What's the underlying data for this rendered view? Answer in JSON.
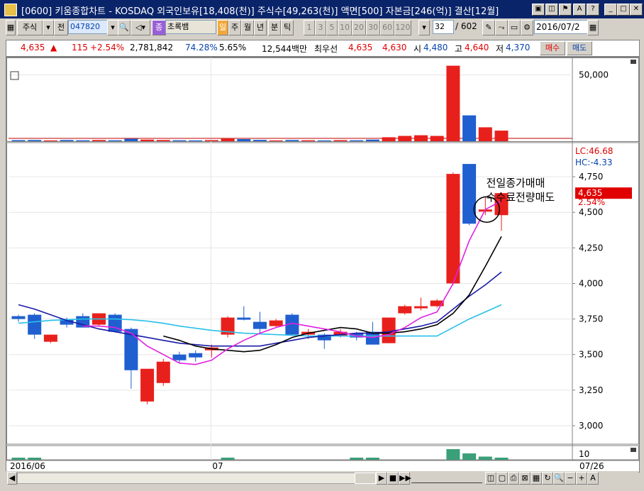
{
  "window": {
    "title": "[0600] 키움종합차트 - KOSDAQ 외국인보유[18,408(천)] 주식수[49,263(천)] 액면[500] 자본금[246(억)] 결산[12월]"
  },
  "toolbar": {
    "type_label": "주식",
    "prev_label": "전",
    "code_value": "047820",
    "color_label": "종",
    "stock_name": "초록뱀",
    "period_day": "일",
    "period_week": "주",
    "period_month": "월",
    "period_year": "년",
    "period_minute": "분",
    "period_tick": "틱",
    "intervals": [
      "1",
      "3",
      "5",
      "10",
      "20",
      "30",
      "60",
      "120"
    ],
    "count_value": "32",
    "count_total": "/ 602",
    "date_value": "2016/07/2"
  },
  "quote": {
    "price": "4,635",
    "change_arrow": "▲",
    "change": "115",
    "change_pct": "+2.54%",
    "volume": "2,781,842",
    "vol_ratio": "74.28%",
    "turnover": "5.65%",
    "amount": "12,544백만",
    "best_label": "최우선",
    "best_ask": "4,635",
    "best_bid": "4,630",
    "open_label": "시",
    "open": "4,480",
    "high_label": "고",
    "high": "4,640",
    "low_label": "저",
    "low": "4,370",
    "buy_label": "매수",
    "sell_label": "매도"
  },
  "chart_data": {
    "type": "candlestick",
    "x_tick_labels": [
      "2016/06",
      "07",
      "07/26"
    ],
    "volume_axis_ticks": [
      "50,000"
    ],
    "price_axis_ticks": [
      "4,750",
      "4,500",
      "4,250",
      "4,000",
      "3,750",
      "3,500",
      "3,250",
      "3,000"
    ],
    "indicator_axis_ticks": [
      "10"
    ],
    "lc_label": "LC:46.68",
    "hc_label": "HC:-4.33",
    "current_price_label": "4,635",
    "current_pct_label": "2.54%",
    "annotation_line1": "전일종가매매",
    "annotation_line2": "수수료전량매도",
    "colors": {
      "up": "#e8201c",
      "down": "#1f5fcf",
      "ma5": "#e020e0",
      "ma10": "#000000",
      "ma20": "#1a1aa8",
      "ma60": "#28c0e8"
    },
    "candles": [
      {
        "o": 3770,
        "h": 3780,
        "l": 3730,
        "c": 3750,
        "v": 800
      },
      {
        "o": 3780,
        "h": 3790,
        "l": 3610,
        "c": 3640,
        "v": 900
      },
      {
        "o": 3590,
        "h": 3640,
        "l": 3580,
        "c": 3640,
        "v": 600
      },
      {
        "o": 3750,
        "h": 3760,
        "l": 3690,
        "c": 3710,
        "v": 900
      },
      {
        "o": 3770,
        "h": 3790,
        "l": 3690,
        "c": 3690,
        "v": 700
      },
      {
        "o": 3710,
        "h": 3790,
        "l": 3700,
        "c": 3790,
        "v": 900
      },
      {
        "o": 3780,
        "h": 3790,
        "l": 3660,
        "c": 3660,
        "v": 700
      },
      {
        "o": 3680,
        "h": 3690,
        "l": 3260,
        "c": 3390,
        "v": 1800
      },
      {
        "o": 3170,
        "h": 3400,
        "l": 3150,
        "c": 3400,
        "v": 1200
      },
      {
        "o": 3300,
        "h": 3470,
        "l": 3280,
        "c": 3450,
        "v": 900
      },
      {
        "o": 3500,
        "h": 3520,
        "l": 3440,
        "c": 3460,
        "v": 700
      },
      {
        "o": 3510,
        "h": 3530,
        "l": 3450,
        "c": 3480,
        "v": 600
      },
      {
        "o": 3530,
        "h": 3570,
        "l": 3480,
        "c": 3550,
        "v": 800
      },
      {
        "o": 3640,
        "h": 3770,
        "l": 3620,
        "c": 3760,
        "v": 1800
      },
      {
        "o": 3760,
        "h": 3840,
        "l": 3740,
        "c": 3750,
        "v": 1600
      },
      {
        "o": 3730,
        "h": 3800,
        "l": 3650,
        "c": 3680,
        "v": 1000
      },
      {
        "o": 3700,
        "h": 3750,
        "l": 3690,
        "c": 3740,
        "v": 600
      },
      {
        "o": 3780,
        "h": 3790,
        "l": 3640,
        "c": 3640,
        "v": 900
      },
      {
        "o": 3640,
        "h": 3680,
        "l": 3610,
        "c": 3660,
        "v": 700
      },
      {
        "o": 3640,
        "h": 3650,
        "l": 3540,
        "c": 3600,
        "v": 600
      },
      {
        "o": 3630,
        "h": 3680,
        "l": 3620,
        "c": 3660,
        "v": 800
      },
      {
        "o": 3650,
        "h": 3660,
        "l": 3600,
        "c": 3620,
        "v": 700
      },
      {
        "o": 3660,
        "h": 3730,
        "l": 3570,
        "c": 3570,
        "v": 1200
      },
      {
        "o": 3580,
        "h": 3760,
        "l": 3580,
        "c": 3760,
        "v": 3000
      },
      {
        "o": 3790,
        "h": 3850,
        "l": 3780,
        "c": 3840,
        "v": 4000
      },
      {
        "o": 3830,
        "h": 3900,
        "l": 3810,
        "c": 3840,
        "v": 4500
      },
      {
        "o": 3840,
        "h": 3890,
        "l": 3830,
        "c": 3880,
        "v": 4000
      },
      {
        "o": 4000,
        "h": 4780,
        "l": 3990,
        "c": 4770,
        "v": 57000
      },
      {
        "o": 4840,
        "h": 4840,
        "l": 4410,
        "c": 4420,
        "v": 19500
      },
      {
        "o": 4520,
        "h": 4610,
        "l": 4480,
        "c": 4520,
        "v": 10500
      },
      {
        "o": 4480,
        "h": 4640,
        "l": 4370,
        "c": 4635,
        "v": 8000
      }
    ],
    "ma5": [
      null,
      null,
      null,
      null,
      3700,
      3700,
      3690,
      3650,
      3560,
      3500,
      3440,
      3430,
      3460,
      3540,
      3600,
      3650,
      3690,
      3720,
      3700,
      3680,
      3660,
      3630,
      3620,
      3640,
      3690,
      3760,
      3800,
      4000,
      4300,
      4520,
      4580
    ],
    "ma10": [
      null,
      null,
      null,
      null,
      null,
      null,
      null,
      null,
      null,
      3630,
      3600,
      3560,
      3540,
      3530,
      3520,
      3530,
      3570,
      3620,
      3650,
      3670,
      3690,
      3680,
      3650,
      3650,
      3660,
      3680,
      3710,
      3790,
      3920,
      4120,
      4330
    ],
    "ma20": [
      3850,
      3820,
      3780,
      3740,
      3710,
      3680,
      3660,
      3640,
      3620,
      3600,
      3580,
      3570,
      3560,
      3560,
      3560,
      3560,
      3580,
      3600,
      3620,
      3630,
      3640,
      3650,
      3650,
      3660,
      3680,
      3700,
      3730,
      3820,
      3910,
      3990,
      4080
    ],
    "ma60": [
      3720,
      3730,
      3740,
      3745,
      3750,
      3750,
      3750,
      3745,
      3735,
      3720,
      3700,
      3685,
      3670,
      3660,
      3650,
      3645,
      3640,
      3635,
      3630,
      3630,
      3630,
      3630,
      3630,
      3630,
      3630,
      3630,
      3630,
      3690,
      3750,
      3800,
      3850
    ],
    "indicator": [
      1,
      1,
      0,
      0,
      0,
      0,
      0,
      0,
      0,
      0,
      0,
      0,
      0,
      1,
      0,
      0,
      0,
      0,
      0,
      0,
      0,
      1,
      1,
      0,
      0,
      0,
      0,
      5,
      3,
      1.5,
      1
    ]
  },
  "footer": {
    "nav_prev": "◀",
    "nav_next": "▶"
  }
}
